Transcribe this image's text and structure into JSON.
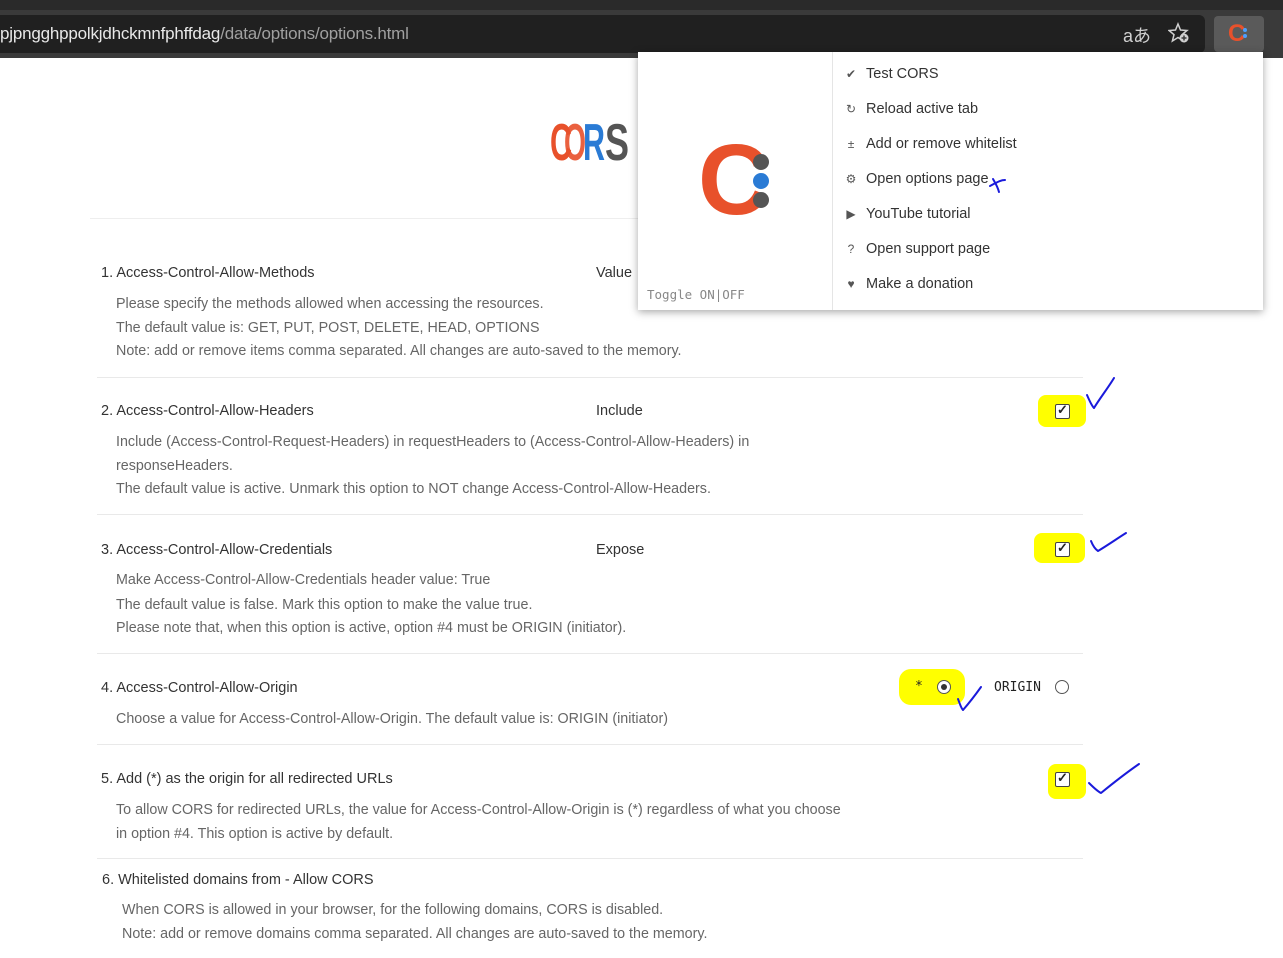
{
  "browser": {
    "url_main": "pjpngghppolkjdhckmnfphffdag",
    "url_path": "/data/options/options.html",
    "translate_icon": "translate-icon",
    "bookmark_icon": "star-add-icon",
    "extension_icon": "cors-extension-icon"
  },
  "logo": {
    "letters": [
      "C",
      "O",
      "R",
      "S"
    ]
  },
  "rows": [
    {
      "number": "1.",
      "title": "Access-Control-Allow-Methods",
      "label": "Value",
      "desc": [
        "Please specify the methods allowed when accessing the resources.",
        "The default value is: GET, PUT, POST, DELETE, HEAD, OPTIONS",
        "Note: add or remove items comma separated. All changes are auto-saved to the memory."
      ]
    },
    {
      "number": "2.",
      "title": "Access-Control-Allow-Headers",
      "label": "Include",
      "checked": true,
      "desc": [
        "Include (Access-Control-Request-Headers) in requestHeaders to (Access-Control-Allow-Headers) in",
        "responseHeaders.",
        "The default value is active. Unmark this option to NOT change Access-Control-Allow-Headers."
      ]
    },
    {
      "number": "3.",
      "title": "Access-Control-Allow-Credentials",
      "label": "Expose",
      "checked": true,
      "desc": [
        "Make Access-Control-Allow-Credentials header value: True",
        "The default value is false. Mark this option to make the value true.",
        "Please note that, when this option is active, option #4 must be ORIGIN (initiator)."
      ]
    },
    {
      "number": "4.",
      "title": "Access-Control-Allow-Origin",
      "option_star": "*",
      "option_origin": "ORIGIN",
      "selected": "*",
      "desc": [
        "Choose a value for Access-Control-Allow-Origin. The default value is: ORIGIN (initiator)"
      ]
    },
    {
      "number": "5.",
      "title": "Add (*) as the origin for all redirected URLs",
      "checked": true,
      "desc": [
        "To allow CORS for redirected URLs, the value for Access-Control-Allow-Origin is (*) regardless of what you choose",
        "in option #4. This option is active by default."
      ]
    },
    {
      "number": "6.",
      "title": "Whitelisted domains from - Allow CORS",
      "desc": [
        "When CORS is allowed in your browser, for the following domains, CORS is disabled.",
        "Note: add or remove domains comma separated. All changes are auto-saved to the memory."
      ]
    }
  ],
  "popup": {
    "toggle_label": "Toggle ON|OFF",
    "menu": [
      {
        "icon": "check-icon",
        "label": "Test CORS"
      },
      {
        "icon": "reload-icon",
        "label": "Reload active tab"
      },
      {
        "icon": "plus-minus-icon",
        "label": "Add or remove whitelist"
      },
      {
        "icon": "gear-icon",
        "label": "Open options page"
      },
      {
        "icon": "play-icon",
        "label": "YouTube tutorial"
      },
      {
        "icon": "question-icon",
        "label": "Open support page"
      },
      {
        "icon": "heart-icon",
        "label": "Make a donation"
      }
    ]
  },
  "colors": {
    "brand_red": "#e8512b",
    "brand_blue": "#2a7bd5",
    "brand_gray": "#555555",
    "highlight": "#ffff00",
    "annotation_ink": "#1a1adb"
  }
}
